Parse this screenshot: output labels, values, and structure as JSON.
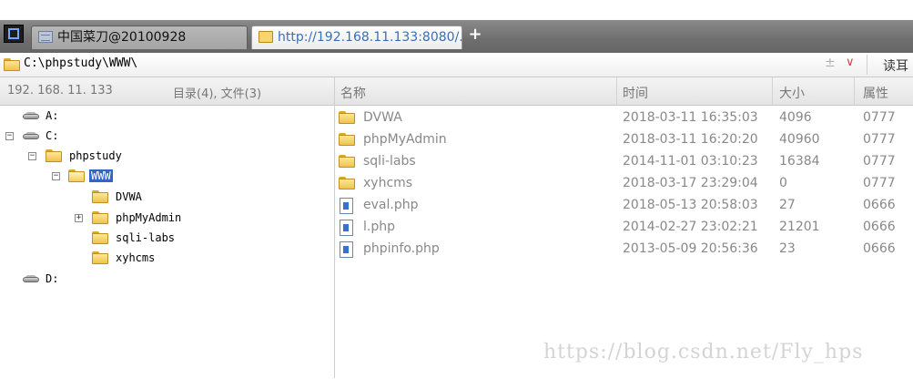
{
  "tabs": [
    {
      "label": "中国菜刀@20100928"
    },
    {
      "label": "http://192.168.11.133:8080/..."
    }
  ],
  "new_tab_label": "+",
  "address_bar": {
    "path": "C:\\phpstudy\\WWW\\",
    "history_toggle": "±",
    "dropdown": "∨",
    "read_button": "读耳"
  },
  "left_header": {
    "host": "192. 168. 11. 133",
    "summary": "目录(4), 文件(3)"
  },
  "tree": {
    "drive_a": "A:",
    "drive_c": "C:",
    "phpstudy": "phpstudy",
    "www": "WWW",
    "dvwa": "DVWA",
    "phpmyadmin": "phpMyAdmin",
    "sqli_labs": "sqli-labs",
    "xyhcms": "xyhcms",
    "drive_d": "D:"
  },
  "columns": {
    "name": "名称",
    "time": "时间",
    "size": "大小",
    "attr": "属性"
  },
  "files": [
    {
      "name": "DVWA",
      "time": "2018-03-11 16:35:03",
      "size": "4096",
      "attr": "0777",
      "icon": "folder-icon"
    },
    {
      "name": "phpMyAdmin",
      "time": "2018-03-11 16:20:20",
      "size": "40960",
      "attr": "0777",
      "icon": "folder-icon"
    },
    {
      "name": "sqli-labs",
      "time": "2014-11-01 03:10:23",
      "size": "16384",
      "attr": "0777",
      "icon": "folder-icon"
    },
    {
      "name": "xyhcms",
      "time": "2018-03-17 23:29:04",
      "size": "0",
      "attr": "0777",
      "icon": "folder-icon"
    },
    {
      "name": "eval.php",
      "time": "2018-05-13 20:58:03",
      "size": "27",
      "attr": "0666",
      "icon": "php-file-icon"
    },
    {
      "name": "l.php",
      "time": "2014-02-27 23:02:21",
      "size": "21201",
      "attr": "0666",
      "icon": "php-file-icon"
    },
    {
      "name": "phpinfo.php",
      "time": "2013-05-09 20:56:36",
      "size": "23",
      "attr": "0666",
      "icon": "php-file-icon"
    }
  ],
  "watermark": "https://blog.csdn.net/Fly_hps",
  "colors": {
    "tab_bar": "#6e6e6e",
    "selection": "#3165c8",
    "folder": "#f0c24a",
    "text_muted": "#888888"
  }
}
